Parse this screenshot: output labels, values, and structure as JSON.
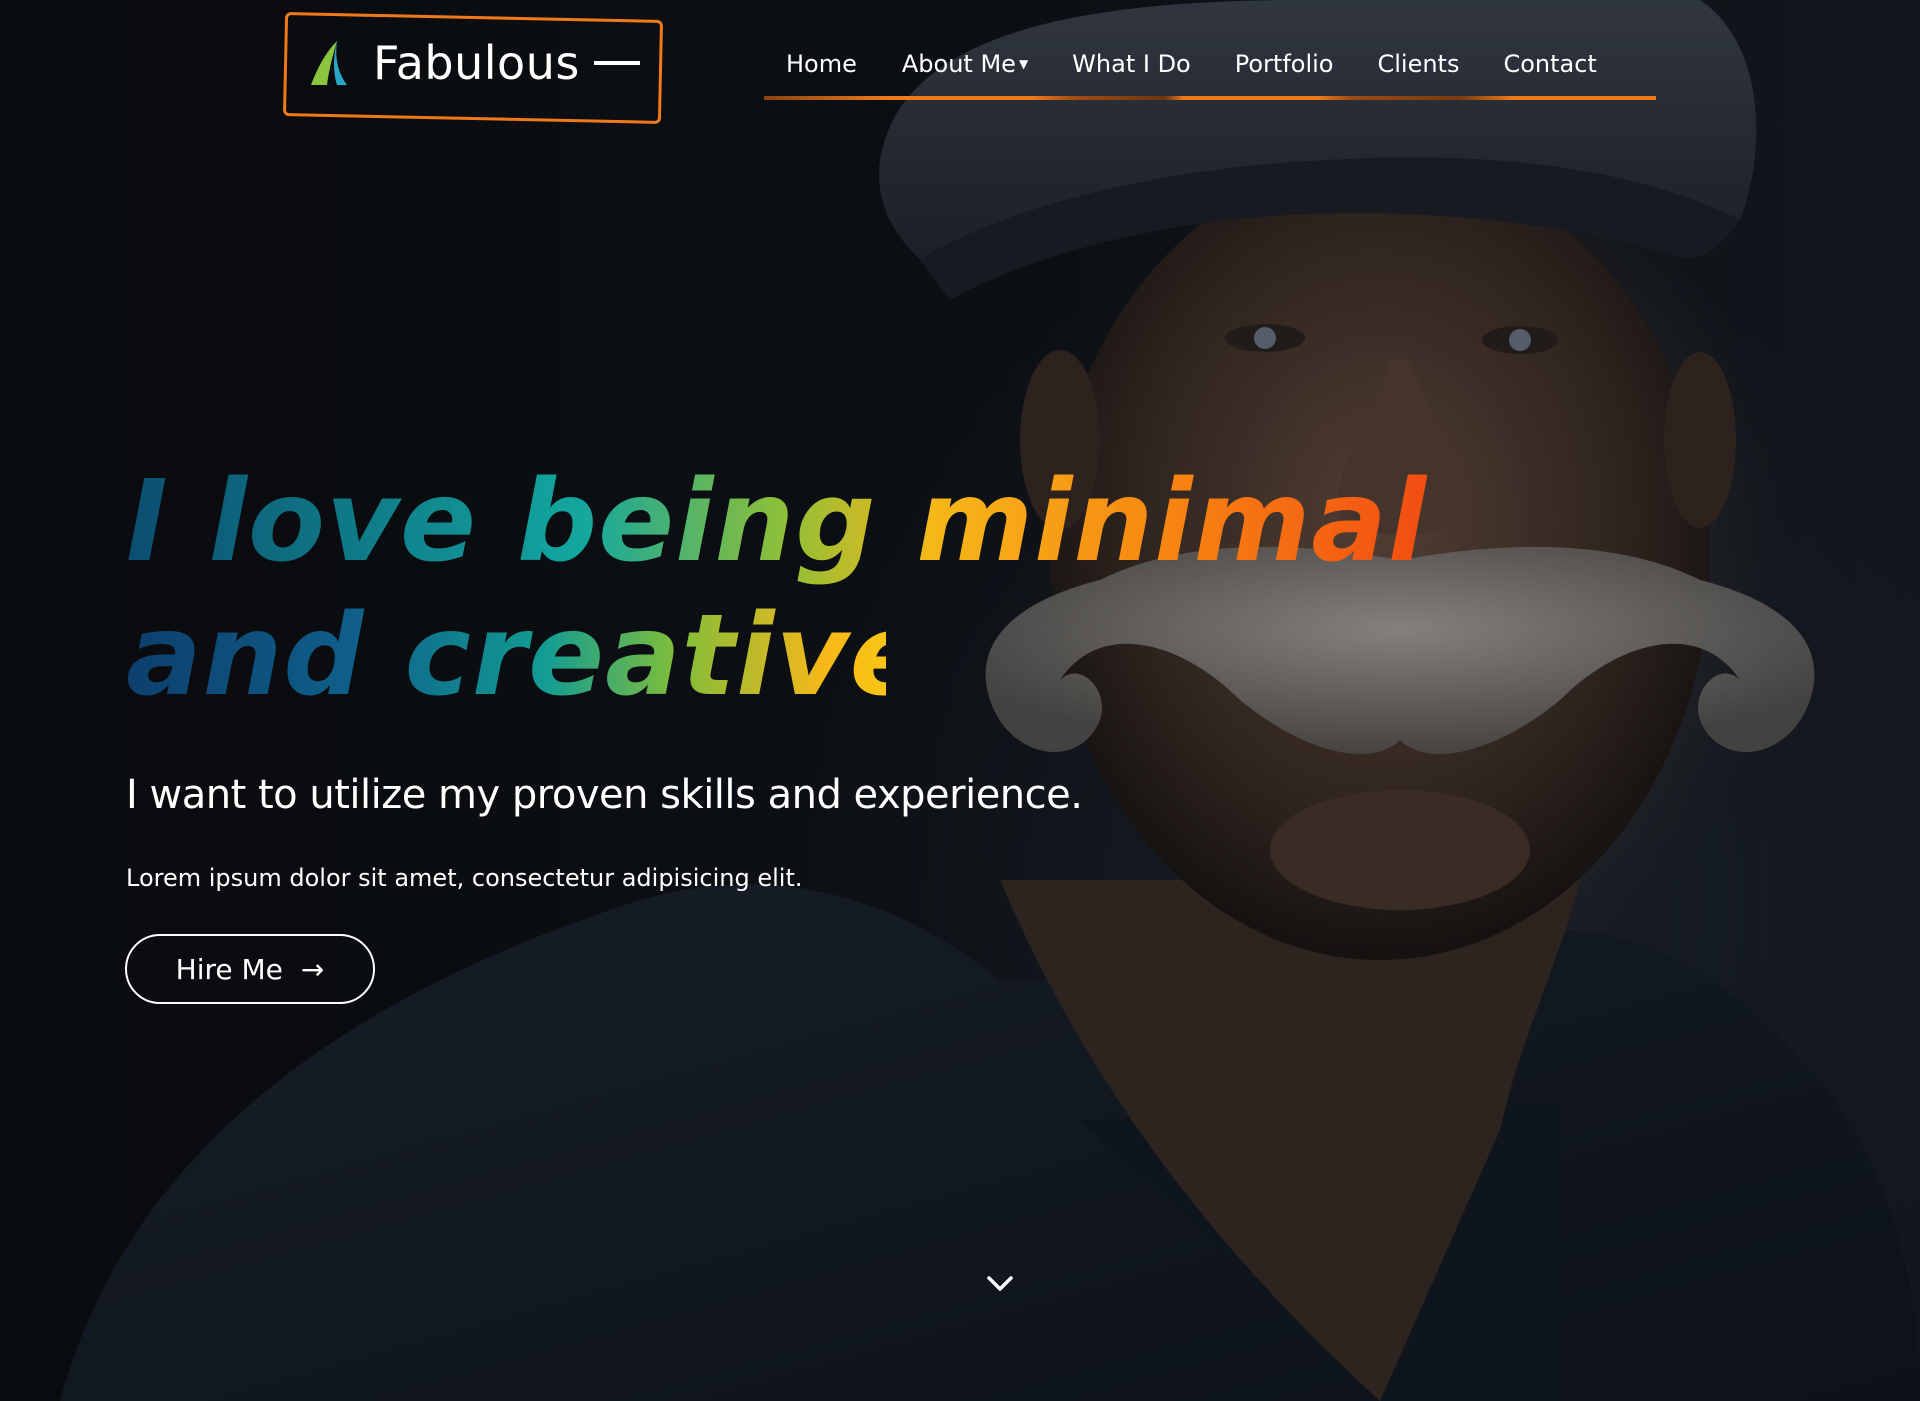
{
  "brand": {
    "name": "Fabulous",
    "logo_icon": "leaf-a-logo-icon",
    "accent_color": "#f07a1a"
  },
  "nav": {
    "items": [
      {
        "label": "Home"
      },
      {
        "label": "About Me",
        "has_dropdown": true
      },
      {
        "label": "What I Do"
      },
      {
        "label": "Portfolio"
      },
      {
        "label": "Clients"
      },
      {
        "label": "Contact"
      }
    ],
    "dropdown_icon": "caret-down-icon"
  },
  "hero": {
    "headline_line1": "I love being minimal",
    "headline_line2": "and creative",
    "subtitle": "I want to utilize my proven skills and experience.",
    "lead": "Lorem ipsum dolor sit amet, consectetur adipisicing elit.",
    "cta_label": "Hire Me",
    "cta_icon": "arrow-right-icon",
    "scroll_icon": "chevron-down-icon"
  }
}
